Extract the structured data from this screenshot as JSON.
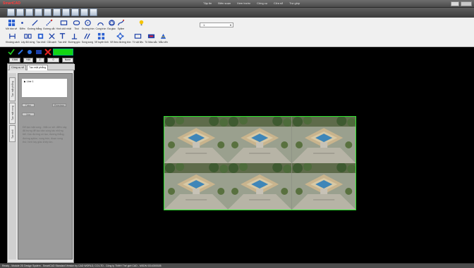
{
  "app": {
    "title": "SmartCAD",
    "title_color": "#ff3b3b"
  },
  "menu": [
    "Tập tin",
    "Biên soạn",
    "Xem trước",
    "Công cụ",
    "Cửa sổ",
    "Trợ giúp"
  ],
  "quick_access": [
    "new-file-icon",
    "open-folder-icon",
    "print-icon",
    "save-icon",
    "cut-icon",
    "copy-icon",
    "paste-icon",
    "properties-icon",
    "undo-icon",
    "redo-icon"
  ],
  "ribbon": {
    "row1": [
      {
        "label": "Mở bản vẽ",
        "icon": "grid-icon"
      },
      {
        "label": "Điểm",
        "icon": "point-icon"
      },
      {
        "label": "Đường thẳng",
        "icon": "line-icon"
      },
      {
        "label": "Đường cắt",
        "icon": "cut-line-icon"
      },
      {
        "label": "Hình chữ nhật",
        "icon": "rectangle-icon"
      },
      {
        "label": "Thoi",
        "icon": "rounded-rect-icon"
      },
      {
        "label": "Đường tròn",
        "icon": "circle-icon"
      },
      {
        "label": "Cung tròn",
        "icon": "arc-icon"
      },
      {
        "label": "Đa giác",
        "icon": "polygon-icon"
      },
      {
        "label": "Spline",
        "icon": "spline-icon"
      }
    ],
    "row2": [
      {
        "label": "Khoảng cách",
        "icon": "distance-icon"
      },
      {
        "label": "Lấy đối xứng",
        "icon": "mirror-icon"
      },
      {
        "label": "Tạo khối",
        "icon": "block-icon"
      },
      {
        "label": "Cắt cạnh",
        "icon": "trim-icon"
      },
      {
        "label": "Tạo chữ",
        "icon": "text-icon"
      },
      {
        "label": "Đường góc",
        "icon": "angle-icon"
      },
      {
        "label": "Song song",
        "icon": "parallel-icon"
      },
      {
        "label": "Vẽ tuyến tính",
        "icon": "array-icon"
      },
      {
        "label": "Vẽ theo đường tròn",
        "icon": "polar-icon"
      },
      {
        "label": "Tô vật liệu",
        "icon": "fill-icon"
      },
      {
        "label": "Tô Màu sắc",
        "icon": "color-icon"
      },
      {
        "label": "Mẫu vẽn",
        "icon": "pattern-icon"
      }
    ],
    "dropdown_value": "1"
  },
  "toolstrip": {
    "swatch_color": "#13d413"
  },
  "coords": {
    "x_label": "X366",
    "y_label": "Y89",
    "z_label": "Z:",
    "z_value": "0",
    "units": "None"
  },
  "panel": {
    "tabs": [
      "Công cụ vẽ",
      "Tạo mặt phẳng"
    ],
    "side_tabs": [
      "Tạo mặt phẳng",
      "Tạo mặt cong",
      "Tạo khối"
    ],
    "list_item": "Line 1",
    "buttons": [
      "Thêm",
      "Phím trực",
      "Xóa"
    ],
    "hint": "Để tạo mặt cong\n- Mặt cơ sở: điểm này đã trưng để tạo bản vùng tác những tiết. Các đường có tạo, đường thẳng, đường spline, cung tròn, đoạn cong thứ, hình tay giác khép kín."
  },
  "status": {
    "text": "Ready - Module 2D Design System - SmartCAD Standard Version by CAD WORLD, CO.LTD - Công ty TNHH Thế giới CAD - MSDN 0314303026"
  }
}
